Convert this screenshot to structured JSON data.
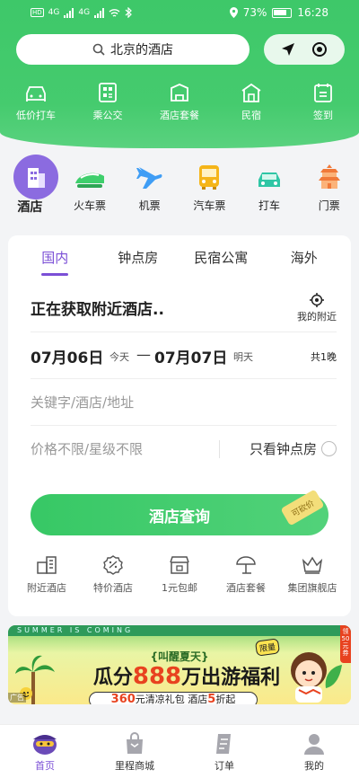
{
  "status_bar": {
    "sim_tags": [
      "HD",
      "4G",
      "4G"
    ],
    "battery": "73%",
    "time": "16:28"
  },
  "search": {
    "placeholder": "北京的酒店"
  },
  "quick_links": [
    {
      "label": "低价打车",
      "icon": "car-icon"
    },
    {
      "label": "乘公交",
      "icon": "bus-qr-icon"
    },
    {
      "label": "酒店套餐",
      "icon": "hotel-package-icon"
    },
    {
      "label": "民宿",
      "icon": "homestay-icon"
    },
    {
      "label": "签到",
      "icon": "sign-in-icon"
    }
  ],
  "categories": [
    {
      "label": "酒店",
      "icon": "hotel-building-icon",
      "active": true
    },
    {
      "label": "火车票",
      "icon": "train-icon"
    },
    {
      "label": "机票",
      "icon": "plane-icon"
    },
    {
      "label": "汽车票",
      "icon": "bus-icon"
    },
    {
      "label": "打车",
      "icon": "taxi-icon"
    },
    {
      "label": "门票",
      "icon": "temple-icon"
    }
  ],
  "booking": {
    "tabs": [
      "国内",
      "钟点房",
      "民宿公寓",
      "海外"
    ],
    "active_tab": "国内",
    "location_text": "正在获取附近酒店..",
    "nearby_label": "我的附近",
    "checkin_date": "07月06日",
    "checkin_day": "今天",
    "checkout_date": "07月07日",
    "checkout_day": "明天",
    "nights": "共1晚",
    "keyword_placeholder": "关键字/酒店/地址",
    "price_placeholder": "价格不限/星级不限",
    "hourly_only_label": "只看钟点房",
    "search_button": "酒店查询",
    "bargain_tag": "可砍价"
  },
  "services": [
    {
      "label": "附近酒店",
      "icon": "nearby-hotel-icon"
    },
    {
      "label": "特价酒店",
      "icon": "discount-icon"
    },
    {
      "label": "1元包邮",
      "icon": "shop-icon"
    },
    {
      "label": "酒店套餐",
      "icon": "parasol-icon"
    },
    {
      "label": "集团旗舰店",
      "icon": "crown-icon"
    }
  ],
  "banner": {
    "strip": "SUMMER IS COMING",
    "subtitle": "{叫醒夏天}",
    "main_pre": "瓜分",
    "main_num": "888",
    "main_post": "万出游福利",
    "badge": "限量",
    "bar_a": "360",
    "bar_b": "元清凉礼包 酒店",
    "bar_c": "5",
    "bar_d": "折起",
    "ad": "广告",
    "coupon": "领50元券"
  },
  "tabbar": [
    {
      "label": "首页",
      "icon": "home-mascot-icon",
      "active": true
    },
    {
      "label": "里程商城",
      "icon": "mall-bag-icon"
    },
    {
      "label": "订单",
      "icon": "order-icon"
    },
    {
      "label": "我的",
      "icon": "profile-icon"
    }
  ],
  "colors": {
    "brand_green": "#3ec869",
    "accent_purple": "#7b4fd6",
    "promo_red": "#e8421f"
  }
}
